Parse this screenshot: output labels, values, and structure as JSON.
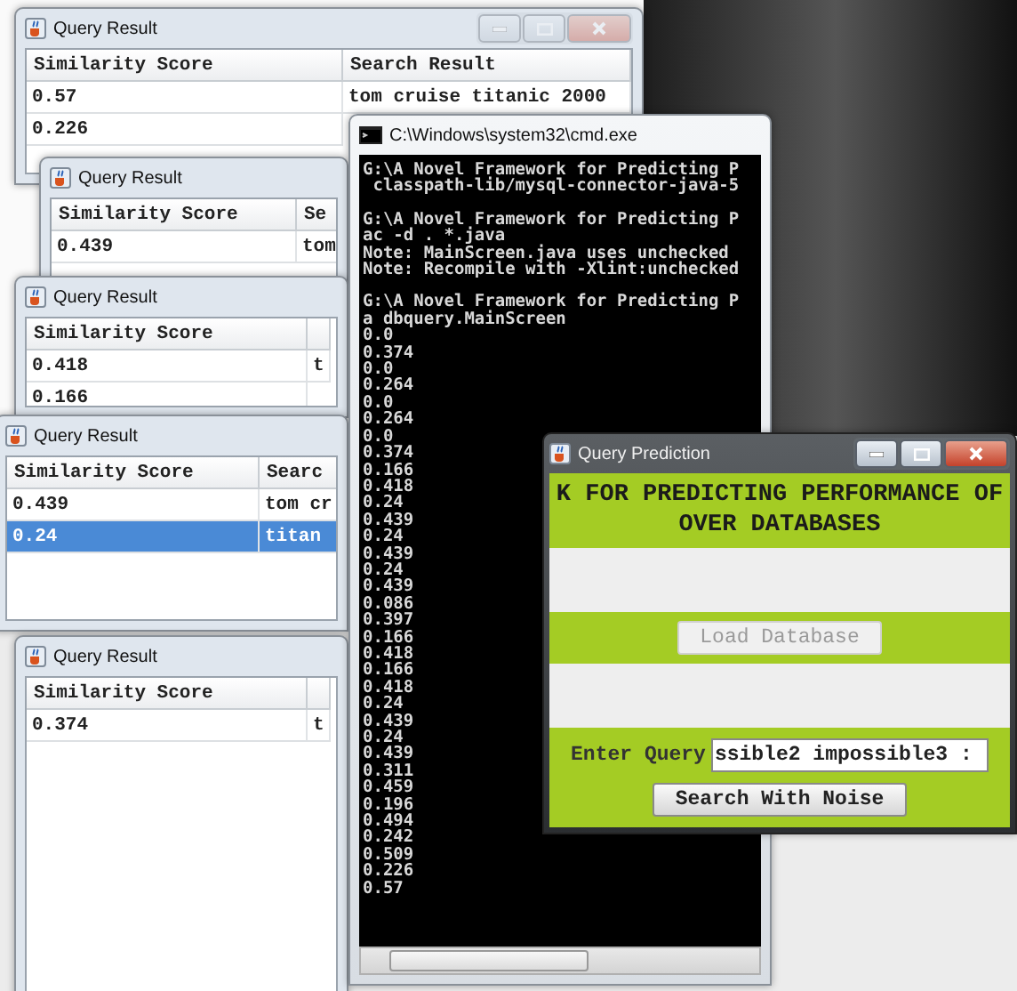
{
  "windows": [
    {
      "title": "Query Result",
      "controls": true,
      "columns": [
        "Similarity Score",
        "Search Result"
      ],
      "rows": [
        {
          "cells": [
            "0.57",
            "tom cruise titanic 2000"
          ],
          "selected": false
        },
        {
          "cells": [
            "0.226"
          ],
          "selected": false
        }
      ]
    },
    {
      "title": "Query Result",
      "controls": false,
      "columns": [
        "Similarity Score",
        "Se"
      ],
      "rows": [
        {
          "cells": [
            "0.439",
            "tom"
          ],
          "selected": false
        }
      ]
    },
    {
      "title": "Query Result",
      "controls": false,
      "columns": [
        "Similarity Score"
      ],
      "rows": [
        {
          "cells": [
            "0.418",
            "t"
          ],
          "selected": false
        },
        {
          "cells": [
            "0.166"
          ],
          "selected": false
        }
      ]
    },
    {
      "title": "Query Result",
      "controls": false,
      "columns": [
        "Similarity Score",
        "Searc"
      ],
      "rows": [
        {
          "cells": [
            "0.439",
            "tom cr"
          ],
          "selected": false
        },
        {
          "cells": [
            "0.24",
            "titan"
          ],
          "selected": true
        }
      ]
    },
    {
      "title": "Query Result",
      "controls": false,
      "columns": [
        "Similarity Score"
      ],
      "rows": [
        {
          "cells": [
            "0.374",
            "t"
          ],
          "selected": false
        }
      ]
    }
  ],
  "console": {
    "title": "C:\\Windows\\system32\\cmd.exe",
    "blocks": [
      [
        "G:\\A Novel Framework for Predicting P",
        " classpath-lib/mysql-connector-java-5"
      ],
      [
        "G:\\A Novel Framework for Predicting P",
        "ac -d . *.java",
        "Note: MainScreen.java uses unchecked",
        "Note: Recompile with -Xlint:unchecked"
      ],
      [
        "G:\\A Novel Framework for Predicting P",
        "a dbquery.MainScreen",
        "0.0",
        "0.374",
        "0.0",
        "0.264",
        "0.0",
        "0.264",
        "0.0",
        "0.374",
        "0.166",
        "0.418",
        "0.24",
        "0.439",
        "0.24",
        "0.439",
        "0.24",
        "0.439",
        "0.086",
        "0.397",
        "0.166",
        "0.418",
        "0.166",
        "0.418",
        "0.24",
        "0.439",
        "0.24",
        "0.439",
        "0.311",
        "0.459",
        "0.196",
        "0.494",
        "0.242",
        "0.509",
        "0.226",
        "0.57"
      ]
    ]
  },
  "prediction": {
    "title": "Query Prediction",
    "heading": [
      "K FOR PREDICTING PERFORMANCE OF",
      "OVER DATABASES"
    ],
    "load_button": {
      "label": "Load Database",
      "disabled": true
    },
    "query_label": "Enter Query",
    "query_value": "ssible2 impossible3 :",
    "search_button": {
      "label": "Search With Noise",
      "disabled": false
    }
  }
}
